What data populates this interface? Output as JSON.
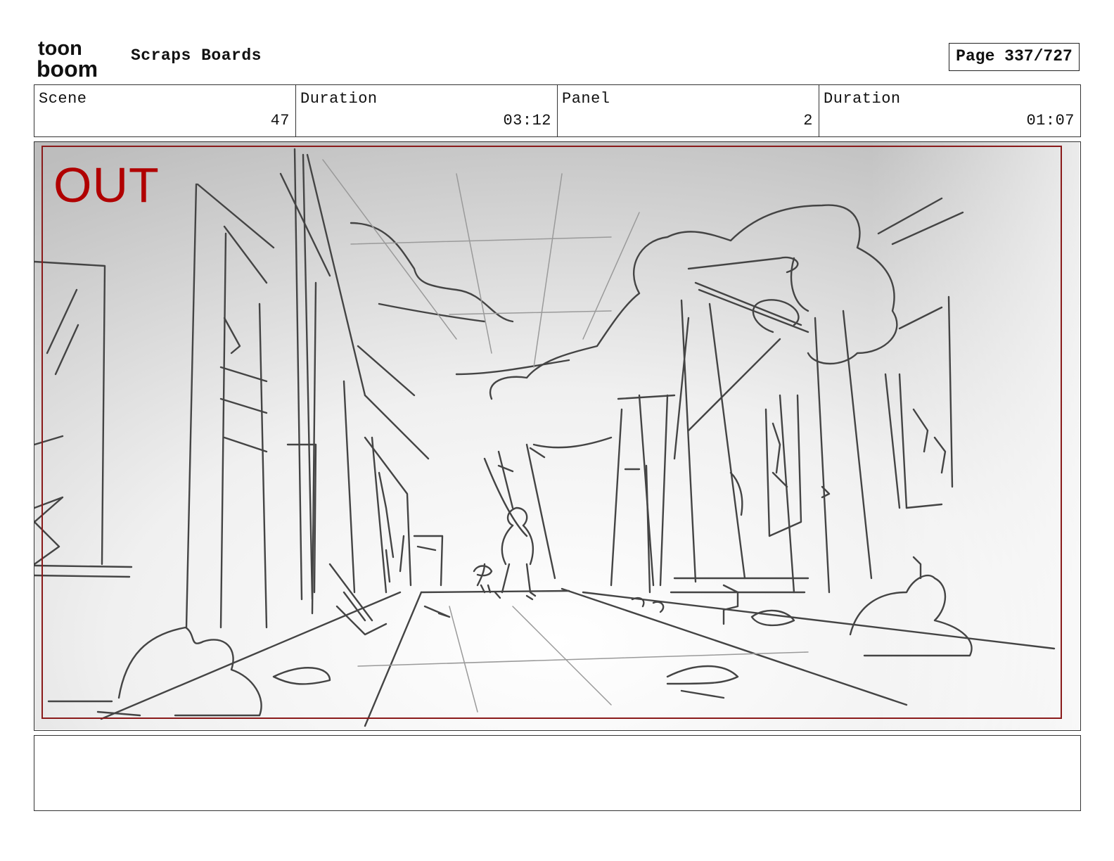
{
  "header": {
    "brand_line1": "toon",
    "brand_line2": "boom",
    "title": "Scraps Boards",
    "page_counter": "Page 337/727"
  },
  "info": [
    {
      "label": "Scene",
      "value": "47"
    },
    {
      "label": "Duration",
      "value": "03:12"
    },
    {
      "label": "Panel",
      "value": "2"
    },
    {
      "label": "Duration",
      "value": "01:07"
    }
  ],
  "panel": {
    "marker": "OUT",
    "marker_color": "#b00000",
    "safe_frame_color": "#8a1a1a",
    "sketch_color": "#444444"
  },
  "notes": {
    "text": ""
  }
}
